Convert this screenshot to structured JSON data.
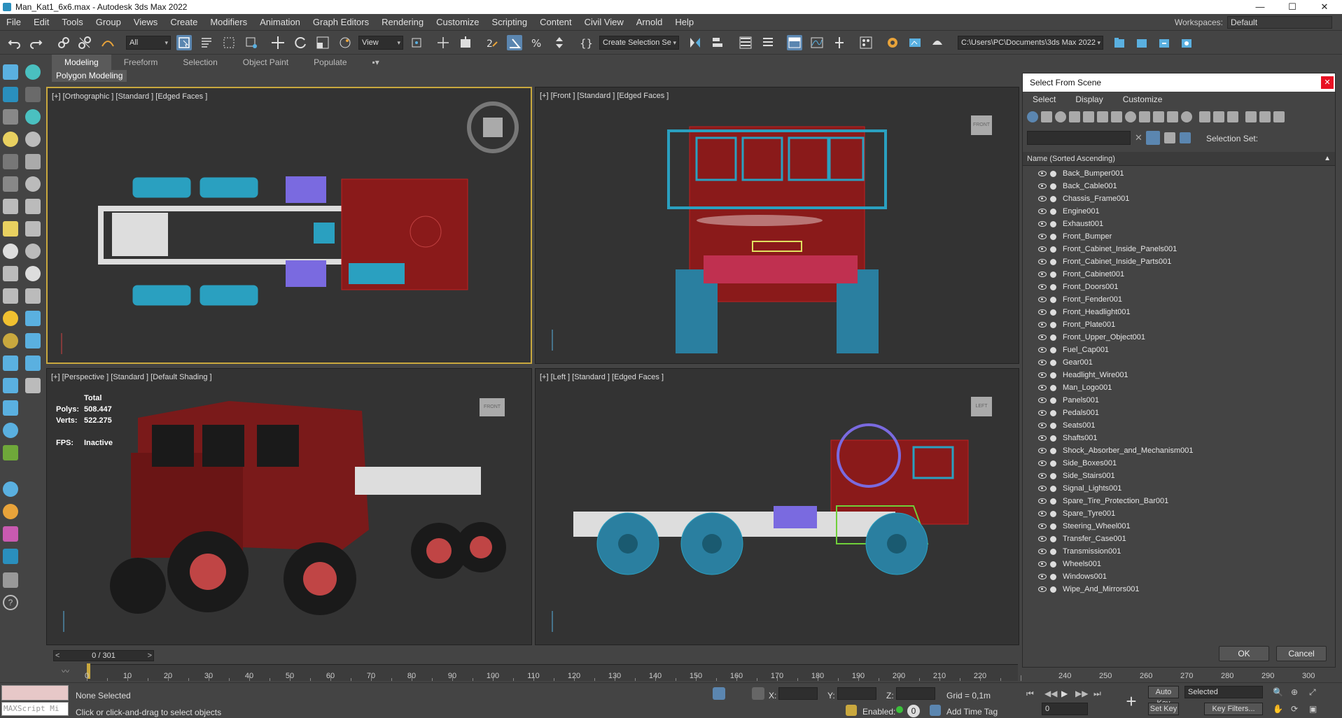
{
  "window": {
    "title": "Man_Kat1_6x6.max - Autodesk 3ds Max 2022",
    "minimize": "—",
    "maximize": "☐",
    "close": "✕"
  },
  "menu": [
    "File",
    "Edit",
    "Tools",
    "Group",
    "Views",
    "Create",
    "Modifiers",
    "Animation",
    "Graph Editors",
    "Rendering",
    "Customize",
    "Scripting",
    "Content",
    "Civil View",
    "Arnold",
    "Help"
  ],
  "workspaces": {
    "label": "Workspaces:",
    "value": "Default"
  },
  "toolbar": {
    "filter": "All",
    "refcoord": "View",
    "selection_set": "Create Selection Se",
    "project_path": "C:\\Users\\PC\\Documents\\3ds Max 2022"
  },
  "ribbon": {
    "tabs": [
      "Modeling",
      "Freeform",
      "Selection",
      "Object Paint",
      "Populate"
    ],
    "active": "Modeling",
    "panel": "Polygon Modeling"
  },
  "viewports": {
    "top_left": "[+] [Orthographic ] [Standard ] [Edged Faces ]",
    "top_right": "[+] [Front ] [Standard ] [Edged Faces ]",
    "bottom_left": "[+] [Perspective ] [Standard ] [Default Shading ]",
    "bottom_right": "[+] [Left ] [Standard ] [Edged Faces ]",
    "viewcube_front": "FRONT",
    "viewcube_left": "LEFT",
    "viewcube_persp": "FRONT"
  },
  "stats": {
    "total": "Total",
    "polys_label": "Polys:",
    "polys": "508.447",
    "verts_label": "Verts:",
    "verts": "522.275",
    "fps_label": "FPS:",
    "fps": "Inactive"
  },
  "timeline": {
    "frame": "0 / 301",
    "ticks": [
      "0",
      "10",
      "20",
      "30",
      "40",
      "50",
      "60",
      "70",
      "80",
      "90",
      "100",
      "110",
      "120",
      "130",
      "140",
      "150",
      "160",
      "170",
      "180",
      "190",
      "200",
      "210",
      "220",
      "230",
      "240",
      "250",
      "260",
      "270",
      "280",
      "290",
      "300"
    ]
  },
  "status": {
    "selection": "None Selected",
    "prompt": "Click or click-and-drag to select objects",
    "maxscript": "MAXScript Mi",
    "x_label": "X:",
    "y_label": "Y:",
    "z_label": "Z:",
    "grid": "Grid = 0,1m",
    "enabled_label": "Enabled:",
    "enabled_value": "0",
    "add_time_tag": "Add Time Tag",
    "auto_key": "Auto Key",
    "set_key": "Set Key",
    "selected": "Selected",
    "key_filters": "Key Filters...",
    "frame_value": "0"
  },
  "dialog": {
    "title": "Select From Scene",
    "close": "✕",
    "menu": [
      "Select",
      "Display",
      "Customize"
    ],
    "selection_set_label": "Selection Set:",
    "column_header": "Name (Sorted Ascending)",
    "ok": "OK",
    "cancel": "Cancel",
    "objects": [
      "Back_Bumper001",
      "Back_Cable001",
      "Chassis_Frame001",
      "Engine001",
      "Exhaust001",
      "Front_Bumper",
      "Front_Cabinet_Inside_Panels001",
      "Front_Cabinet_Inside_Parts001",
      "Front_Cabinet001",
      "Front_Doors001",
      "Front_Fender001",
      "Front_Headlight001",
      "Front_Plate001",
      "Front_Upper_Object001",
      "Fuel_Cap001",
      "Gear001",
      "Headlight_Wire001",
      "Man_Logo001",
      "Panels001",
      "Pedals001",
      "Seats001",
      "Shafts001",
      "Shock_Absorber_and_Mechanism001",
      "Side_Boxes001",
      "Side_Stairs001",
      "Signal_Lights001",
      "Spare_Tire_Protection_Bar001",
      "Spare_Tyre001",
      "Steering_Wheel001",
      "Transfer_Case001",
      "Transmission001",
      "Wheels001",
      "Windows001",
      "Wipe_And_Mirrors001"
    ]
  }
}
